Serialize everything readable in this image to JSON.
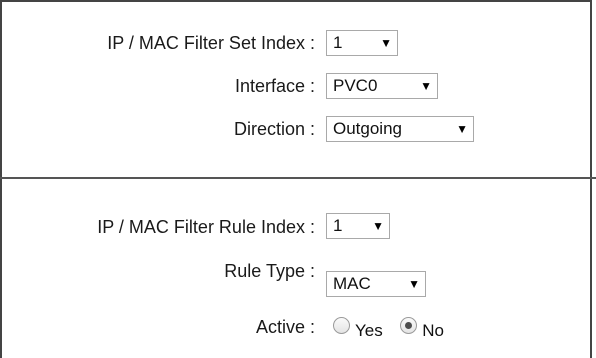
{
  "filter_set": {
    "index_label": "IP / MAC Filter Set Index :",
    "index_value": "1",
    "interface_label": "Interface :",
    "interface_value": "PVC0",
    "direction_label": "Direction :",
    "direction_value": "Outgoing"
  },
  "filter_rule": {
    "index_label": "IP / MAC Filter Rule Index :",
    "index_value": "1",
    "rule_type_label": "Rule Type :",
    "rule_type_value": "MAC",
    "active_label": "Active :",
    "active_options": [
      "Yes",
      "No"
    ],
    "active_selected": "No"
  },
  "icons": {
    "dropdown": "chevron-down-icon"
  }
}
